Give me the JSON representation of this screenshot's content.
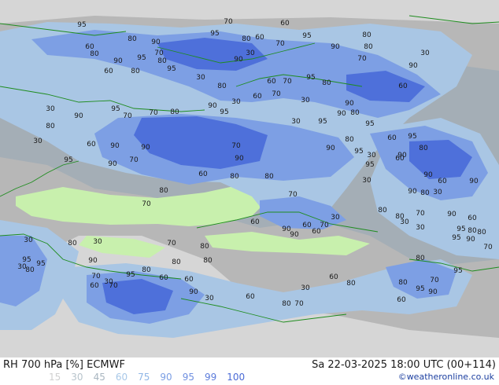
{
  "footer": {
    "title_left": "RH 700 hPa [%] ECMWF",
    "title_right": "Sa 22-03-2025 18:00 UTC (00+114)",
    "copyright": "©weatheronline.co.uk"
  },
  "legend": [
    {
      "value": "15",
      "color": "#d0d0d0"
    },
    {
      "value": "30",
      "color": "#b8c4cc"
    },
    {
      "value": "45",
      "color": "#a9b6c0"
    },
    {
      "value": "60",
      "color": "#a8c8e8"
    },
    {
      "value": "75",
      "color": "#8fb6e6"
    },
    {
      "value": "90",
      "color": "#7a9ee4"
    },
    {
      "value": "95",
      "color": "#6f8fe0"
    },
    {
      "value": "99",
      "color": "#5c7cdb"
    },
    {
      "value": "100",
      "color": "#4a6ad6"
    }
  ],
  "map": {
    "colors": {
      "dry": "#d9d9d9",
      "mid_gray": "#b4b4b4",
      "dark_gray": "#9a9a9a",
      "green_dry": "#c8f2b0",
      "light_blue": "#a7c8e6",
      "mid_blue": "#7fa3e6",
      "deep_blue": "#4f73dc",
      "coast": "#1e8c1e"
    },
    "contour_labels": [
      "95",
      "70",
      "60",
      "95",
      "80",
      "90",
      "80",
      "60",
      "70",
      "95",
      "80",
      "60",
      "80",
      "70",
      "30",
      "80",
      "30",
      "90",
      "95",
      "80",
      "90",
      "90",
      "70",
      "90",
      "95",
      "60",
      "80",
      "30",
      "80",
      "60",
      "70",
      "80",
      "95",
      "60",
      "70",
      "30",
      "30",
      "90",
      "95",
      "70",
      "70",
      "80",
      "90",
      "95",
      "30",
      "90",
      "90",
      "80",
      "95",
      "60",
      "30",
      "80",
      "60",
      "90",
      "90",
      "70",
      "30",
      "95",
      "80",
      "60",
      "95",
      "80",
      "90",
      "95",
      "90",
      "70",
      "60",
      "80",
      "90",
      "95",
      "30",
      "60",
      "90",
      "95",
      "90",
      "80",
      "80",
      "30",
      "90",
      "60",
      "90",
      "80",
      "30",
      "70",
      "70",
      "80",
      "80",
      "70",
      "90",
      "60",
      "30",
      "30",
      "95",
      "80",
      "80",
      "95",
      "90",
      "70",
      "60",
      "90",
      "60",
      "30",
      "70",
      "90",
      "60",
      "30",
      "80",
      "30",
      "70",
      "80",
      "95",
      "90",
      "80",
      "80",
      "30",
      "95",
      "80",
      "70",
      "30",
      "95",
      "80",
      "60",
      "60",
      "80",
      "95",
      "60",
      "70",
      "90",
      "30",
      "60",
      "80",
      "70",
      "80",
      "95",
      "90",
      "30",
      "60",
      "80",
      "70",
      "60"
    ]
  }
}
